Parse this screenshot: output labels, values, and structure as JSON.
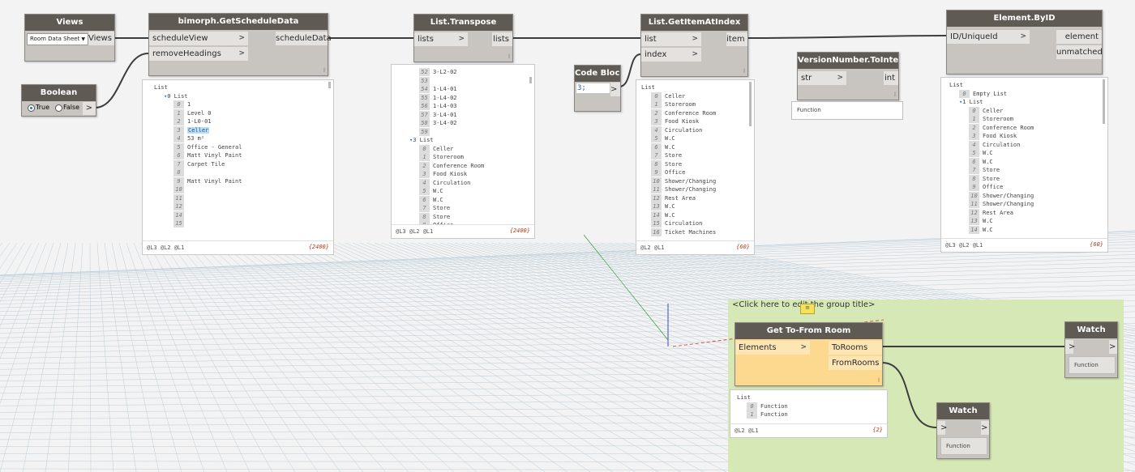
{
  "colors": {
    "canvas": "#f3f3f3",
    "node_header": "#5f5a53",
    "node_body": "#c8c5c0",
    "group_fill": "#d6e8b5",
    "selected_node": "#fcd98f",
    "wire": "#3d3d3d"
  },
  "nodes": {
    "views": {
      "title": "Views",
      "dropdown_value": "Room Data Sheet",
      "out": "Views"
    },
    "boolean": {
      "title": "Boolean",
      "true_label": "True",
      "false_label": "False",
      "out_glyph": ">"
    },
    "get_schedule": {
      "title": "bimorph.GetScheduleData",
      "in1": "scheduleView",
      "in2": "removeHeadings",
      "out": "scheduleData",
      "lacing": "l"
    },
    "transpose": {
      "title": "List.Transpose",
      "in1": "lists",
      "out": "lists",
      "lacing": "l"
    },
    "code_block": {
      "title": "Code Block",
      "code": "3;",
      "out_glyph": ">"
    },
    "get_item": {
      "title": "List.GetItemAtIndex",
      "in1": "list",
      "in2": "index",
      "out": "item",
      "lacing": "l"
    },
    "version": {
      "title": "VersionNumber.ToInteger",
      "in1": "str",
      "out": "int",
      "lacing": "l",
      "preview": "Function"
    },
    "element_by_id": {
      "title": "Element.ByID",
      "in1": "ID/UniqueId",
      "out1": "element",
      "out2": "unmatched"
    },
    "get_to_from": {
      "title": "Get To-From Room",
      "in1": "Elements",
      "out1": "ToRooms",
      "out2": "FromRooms",
      "lacing": "l"
    },
    "watch1": {
      "title": "Watch",
      "in_glyph": ">",
      "out_glyph": ">",
      "value": "Function"
    },
    "watch2": {
      "title": "Watch",
      "in_glyph": ">",
      "out_glyph": ">",
      "value": "Function"
    }
  },
  "group": {
    "title": "<Click here to edit the group title>"
  },
  "previews": {
    "schedule": {
      "rows": [
        {
          "i": "",
          "t": "List",
          "level": 0
        },
        {
          "i": "",
          "t": "0 List",
          "level": 1,
          "caret": true
        },
        {
          "i": "0",
          "t": "1",
          "level": 2
        },
        {
          "i": "1",
          "t": "Level 0",
          "level": 2
        },
        {
          "i": "2",
          "t": "1-L0-01",
          "level": 2
        },
        {
          "i": "3",
          "t": "Celler",
          "level": 2,
          "hl": true
        },
        {
          "i": "4",
          "t": "53 m²",
          "level": 2
        },
        {
          "i": "5",
          "t": "Office - General",
          "level": 2
        },
        {
          "i": "6",
          "t": "Matt Vinyl Paint",
          "level": 2
        },
        {
          "i": "7",
          "t": "Carpet Tile",
          "level": 2
        },
        {
          "i": "8",
          "t": "",
          "level": 2
        },
        {
          "i": "9",
          "t": "Matt Vinyl Paint",
          "level": 2
        },
        {
          "i": "10",
          "t": "",
          "level": 2
        },
        {
          "i": "11",
          "t": "",
          "level": 2
        },
        {
          "i": "12",
          "t": "",
          "level": 2
        },
        {
          "i": "14",
          "t": "",
          "level": 2
        },
        {
          "i": "15",
          "t": "",
          "level": 2
        }
      ],
      "levels": "@L3 @L2 @L1",
      "count": "{2400}"
    },
    "transpose": {
      "rows": [
        {
          "i": "52",
          "t": "3-L2-02",
          "level": 2
        },
        {
          "i": "53",
          "t": "",
          "level": 2
        },
        {
          "i": "54",
          "t": "1-L4-01",
          "level": 2
        },
        {
          "i": "55",
          "t": "1-L4-02",
          "level": 2
        },
        {
          "i": "56",
          "t": "1-L4-03",
          "level": 2
        },
        {
          "i": "57",
          "t": "3-L4-01",
          "level": 2
        },
        {
          "i": "58",
          "t": "3-L4-02",
          "level": 2
        },
        {
          "i": "59",
          "t": "",
          "level": 2
        },
        {
          "i": "",
          "t": "3 List",
          "level": 1,
          "caret": true
        },
        {
          "i": "0",
          "t": "Celler",
          "level": 2
        },
        {
          "i": "1",
          "t": "Storeroom",
          "level": 2
        },
        {
          "i": "2",
          "t": "Conference Room",
          "level": 2
        },
        {
          "i": "3",
          "t": "Food Kiosk",
          "level": 2
        },
        {
          "i": "4",
          "t": "Circulation",
          "level": 2
        },
        {
          "i": "5",
          "t": "W.C",
          "level": 2
        },
        {
          "i": "6",
          "t": "W.C",
          "level": 2
        },
        {
          "i": "7",
          "t": "Store",
          "level": 2
        },
        {
          "i": "8",
          "t": "Store",
          "level": 2
        },
        {
          "i": "9",
          "t": "Office",
          "level": 2
        }
      ],
      "levels": "@L3 @L2 @L1",
      "count": "{2400}"
    },
    "get_item": {
      "rows": [
        {
          "i": "",
          "t": "List",
          "level": 0
        },
        {
          "i": "0",
          "t": "Celler",
          "level": 1
        },
        {
          "i": "1",
          "t": "Storeroom",
          "level": 1
        },
        {
          "i": "2",
          "t": "Conference Room",
          "level": 1
        },
        {
          "i": "3",
          "t": "Food Kiosk",
          "level": 1
        },
        {
          "i": "4",
          "t": "Circulation",
          "level": 1
        },
        {
          "i": "5",
          "t": "W.C",
          "level": 1
        },
        {
          "i": "6",
          "t": "W.C",
          "level": 1
        },
        {
          "i": "7",
          "t": "Store",
          "level": 1
        },
        {
          "i": "8",
          "t": "Store",
          "level": 1
        },
        {
          "i": "9",
          "t": "Office",
          "level": 1
        },
        {
          "i": "10",
          "t": "Shower/Changing",
          "level": 1
        },
        {
          "i": "11",
          "t": "Shower/Changing",
          "level": 1
        },
        {
          "i": "12",
          "t": "Rest Area",
          "level": 1
        },
        {
          "i": "13",
          "t": "W.C",
          "level": 1
        },
        {
          "i": "14",
          "t": "W.C",
          "level": 1
        },
        {
          "i": "15",
          "t": "Circulation",
          "level": 1
        },
        {
          "i": "16",
          "t": "Ticket Machines",
          "level": 1
        }
      ],
      "levels": "@L2 @L1",
      "count": "{60}"
    },
    "element": {
      "rows": [
        {
          "i": "",
          "t": "List",
          "level": 0
        },
        {
          "i": "0",
          "t": "Empty List",
          "level": 1
        },
        {
          "i": "",
          "t": "1 List",
          "level": 1,
          "caret": true
        },
        {
          "i": "0",
          "t": "Celler",
          "level": 2
        },
        {
          "i": "1",
          "t": "Storeroom",
          "level": 2
        },
        {
          "i": "2",
          "t": "Conference Room",
          "level": 2
        },
        {
          "i": "3",
          "t": "Food Kiosk",
          "level": 2
        },
        {
          "i": "4",
          "t": "Circulation",
          "level": 2
        },
        {
          "i": "5",
          "t": "W.C",
          "level": 2
        },
        {
          "i": "6",
          "t": "W.C",
          "level": 2
        },
        {
          "i": "7",
          "t": "Store",
          "level": 2
        },
        {
          "i": "8",
          "t": "Store",
          "level": 2
        },
        {
          "i": "9",
          "t": "Office",
          "level": 2
        },
        {
          "i": "10",
          "t": "Shower/Changing",
          "level": 2
        },
        {
          "i": "11",
          "t": "Shower/Changing",
          "level": 2
        },
        {
          "i": "12",
          "t": "Rest Area",
          "level": 2
        },
        {
          "i": "13",
          "t": "W.C",
          "level": 2
        },
        {
          "i": "14",
          "t": "W.C",
          "level": 2
        }
      ],
      "levels": "@L3 @L2 @L1",
      "count": "{60}"
    },
    "tofrom": {
      "rows": [
        {
          "i": "",
          "t": "List",
          "level": 0
        },
        {
          "i": "0",
          "t": "Function",
          "level": 1
        },
        {
          "i": "1",
          "t": "Function",
          "level": 1
        }
      ],
      "levels": "@L2 @L1",
      "count": "{2}"
    }
  }
}
